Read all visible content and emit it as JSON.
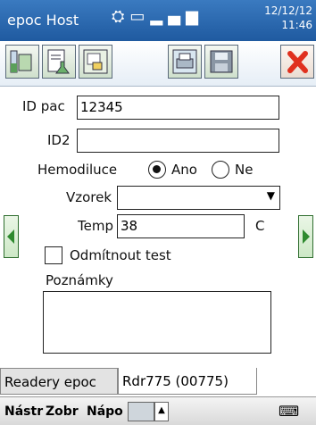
{
  "title_bar": {
    "app_title": "epoc Host",
    "date": "12/12/12",
    "time": "11:46"
  },
  "form": {
    "id_pac_label": "ID pac",
    "id_pac_value": "12345",
    "id2_label": "ID2",
    "id2_value": "",
    "hemodiluce_label": "Hemodiluce",
    "radio_yes_label": "Ano",
    "radio_no_label": "Ne",
    "radio_selected": "Ano",
    "vzorek_label": "Vzorek",
    "vzorek_value": "",
    "temp_label": "Temp",
    "temp_value": "38",
    "temp_unit": "C",
    "reject_label": "Odmítnout test",
    "reject_checked": false,
    "notes_label": "Poznámky",
    "notes_value": ""
  },
  "tabs": [
    {
      "label": "Readery epoc",
      "active": false
    },
    {
      "label": "Rdr775 (00775)",
      "active": true
    }
  ],
  "menu": {
    "item1": "Nástr",
    "item2": "Zobr",
    "item3": "Nápo"
  },
  "icons": {
    "toolbar": [
      "test-tube-icon",
      "document-flask-icon",
      "report-icon",
      "printer-icon",
      "save-icon",
      "close-icon"
    ],
    "nav": [
      "arrow-left-icon",
      "arrow-right-icon"
    ]
  },
  "colors": {
    "titlebar": "#2a6ab0",
    "accent_green": "#2f8a2f",
    "close_red": "#e0301e"
  }
}
